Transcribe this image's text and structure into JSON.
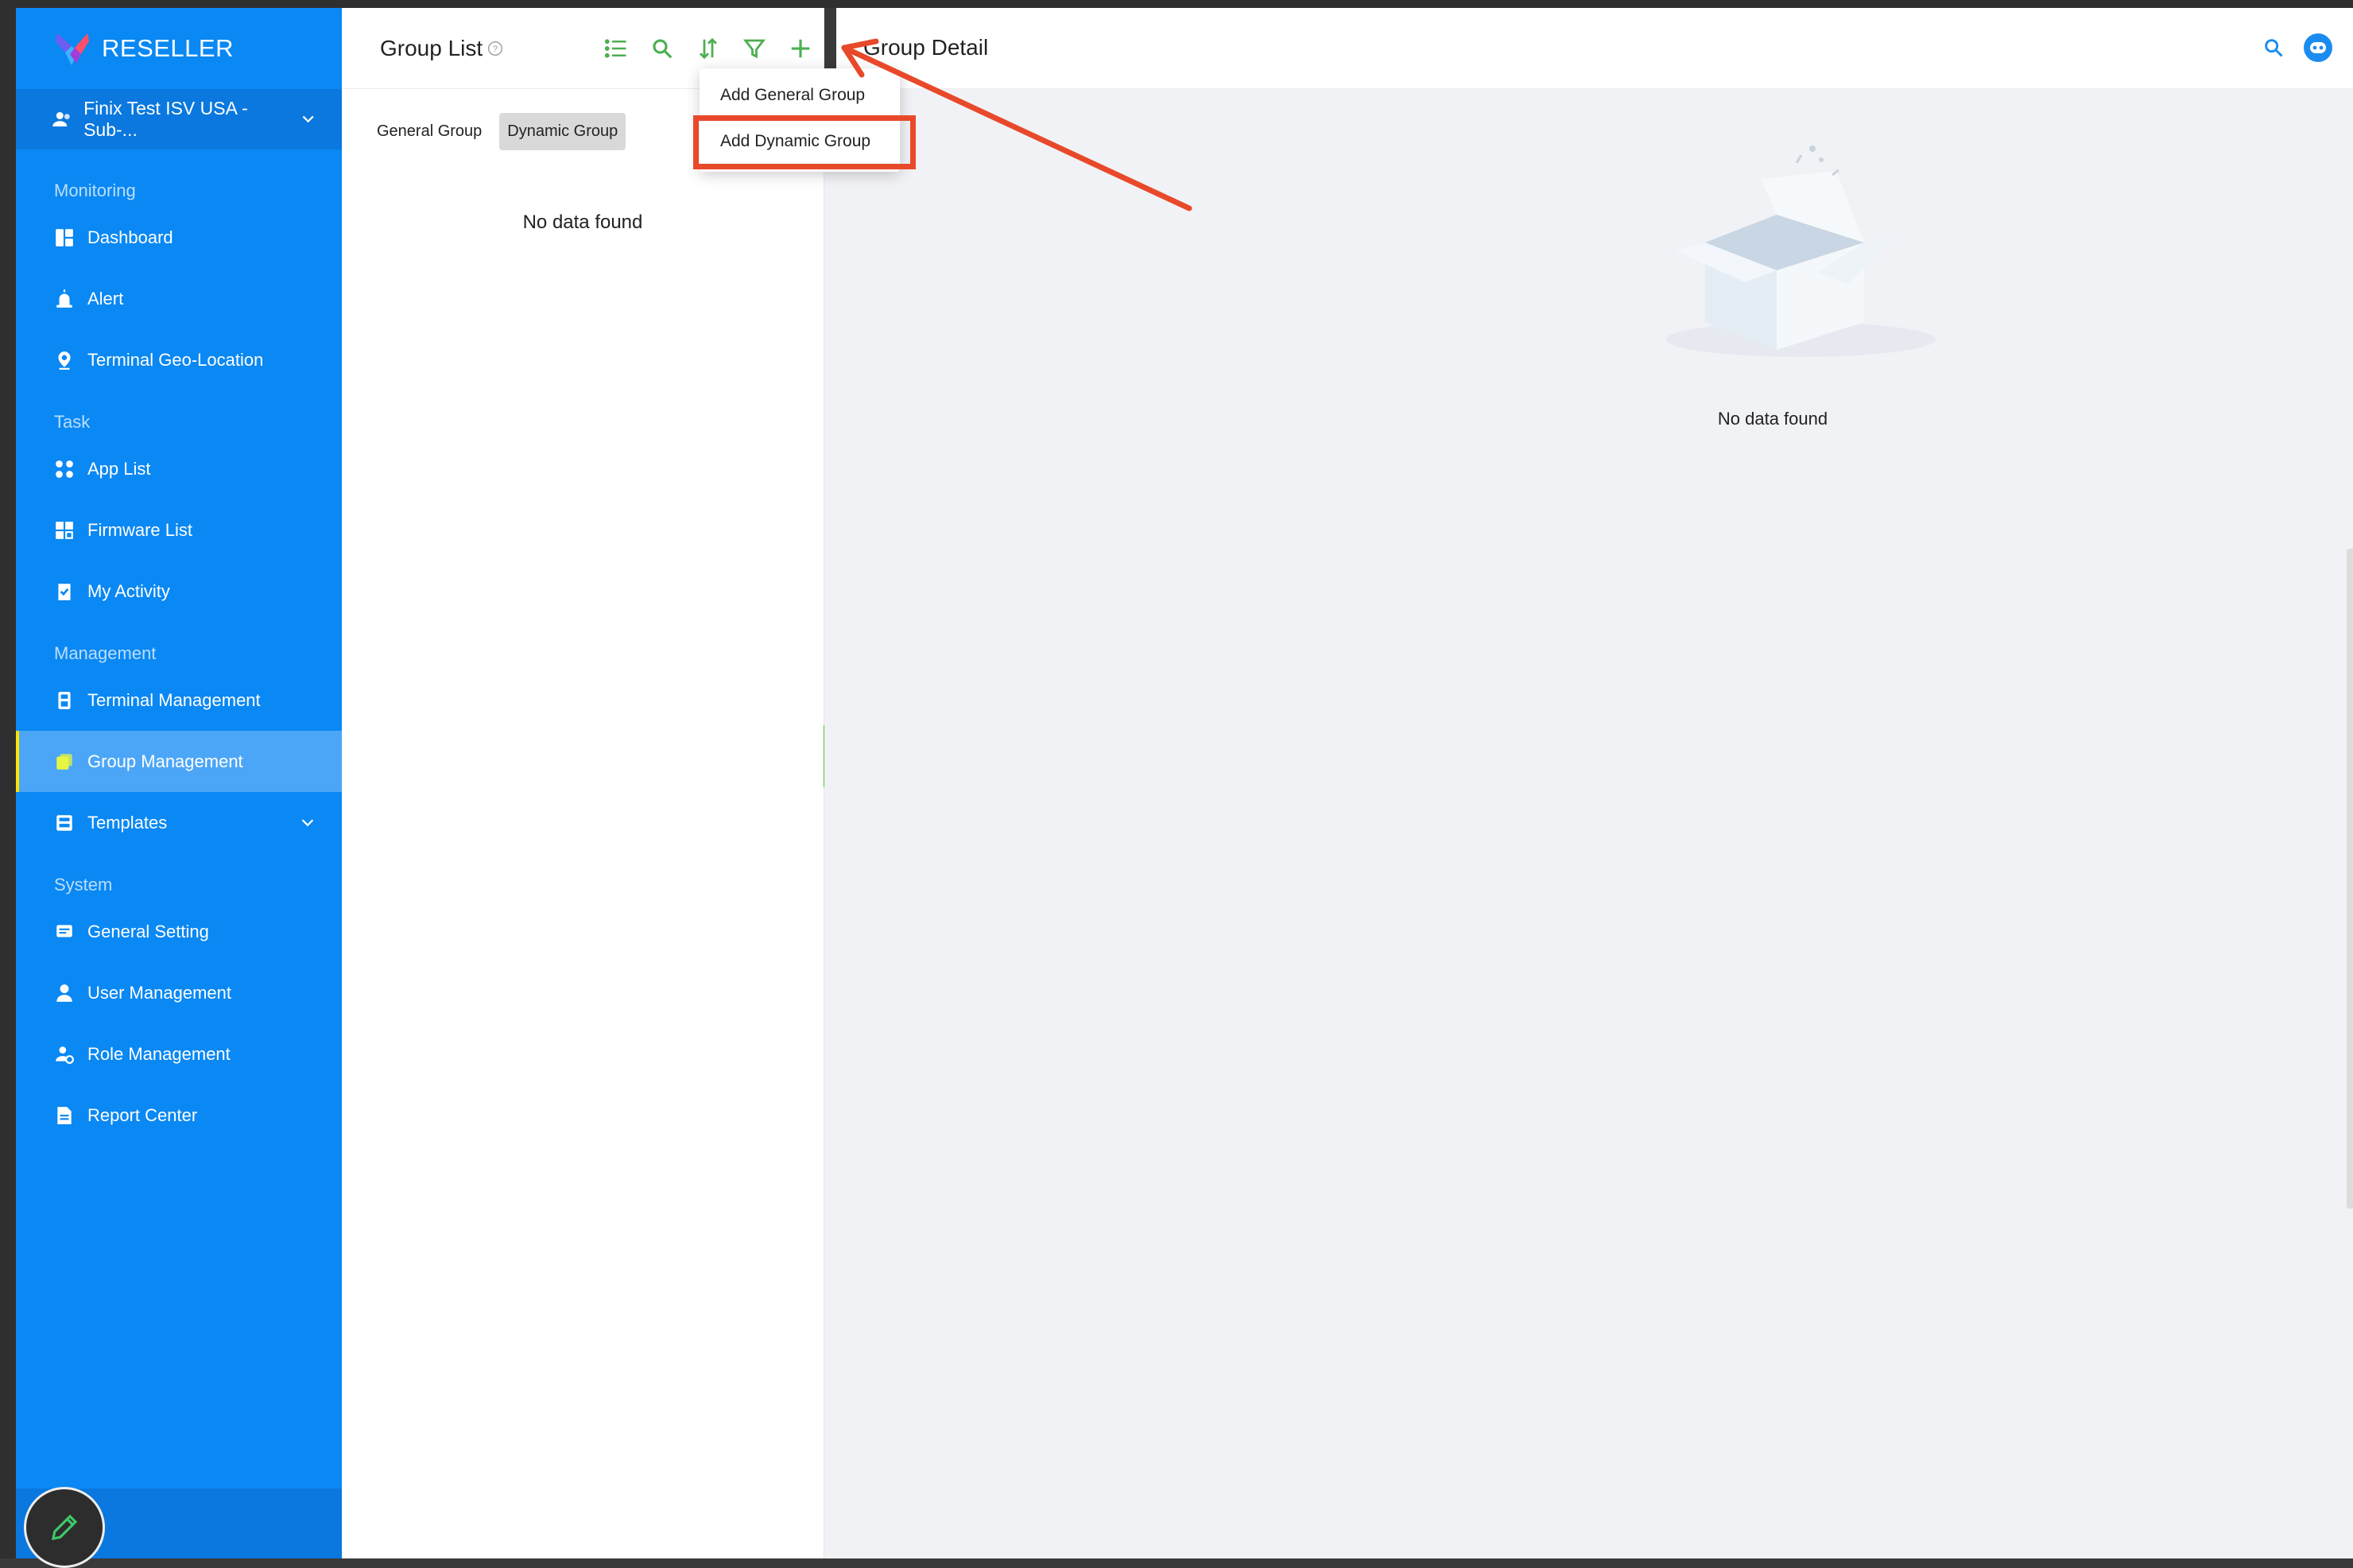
{
  "app": {
    "name": "RESELLER"
  },
  "account": {
    "label": "Finix Test ISV USA - Sub-..."
  },
  "sidebar": {
    "sections": [
      {
        "label": "Monitoring",
        "items": [
          {
            "label": "Dashboard",
            "icon": "dashboard-icon"
          },
          {
            "label": "Alert",
            "icon": "alert-icon"
          },
          {
            "label": "Terminal Geo-Location",
            "icon": "location-pin-icon"
          }
        ]
      },
      {
        "label": "Task",
        "items": [
          {
            "label": "App List",
            "icon": "apps-icon"
          },
          {
            "label": "Firmware List",
            "icon": "firmware-icon"
          },
          {
            "label": "My Activity",
            "icon": "activity-clipboard-icon"
          }
        ]
      },
      {
        "label": "Management",
        "items": [
          {
            "label": "Terminal Management",
            "icon": "terminal-icon"
          },
          {
            "label": "Group Management",
            "icon": "group-icon",
            "active": true
          },
          {
            "label": "Templates",
            "icon": "templates-icon",
            "expandable": true
          }
        ]
      },
      {
        "label": "System",
        "items": [
          {
            "label": "General Setting",
            "icon": "settings-icon"
          },
          {
            "label": "User Management",
            "icon": "user-icon"
          },
          {
            "label": "Role Management",
            "icon": "role-icon"
          },
          {
            "label": "Report Center",
            "icon": "report-icon"
          }
        ]
      }
    ]
  },
  "group_list": {
    "title": "Group List",
    "tabs": [
      {
        "label": "General Group",
        "selected": false
      },
      {
        "label": "Dynamic Group",
        "selected": true
      }
    ],
    "empty_text": "No data found",
    "tools": [
      "list-icon",
      "search-icon",
      "sort-icon",
      "filter-icon",
      "add-icon"
    ]
  },
  "dropdown": {
    "items": [
      {
        "label": "Add General Group"
      },
      {
        "label": "Add Dynamic Group",
        "highlighted": true
      }
    ]
  },
  "group_detail": {
    "title": "Group Detail",
    "empty_text": "No data found"
  },
  "colors": {
    "sidebar": "#0a88f3",
    "accent_green": "#4caf50",
    "annotation_red": "#e8492a",
    "active_indicator": "#ffe200"
  }
}
